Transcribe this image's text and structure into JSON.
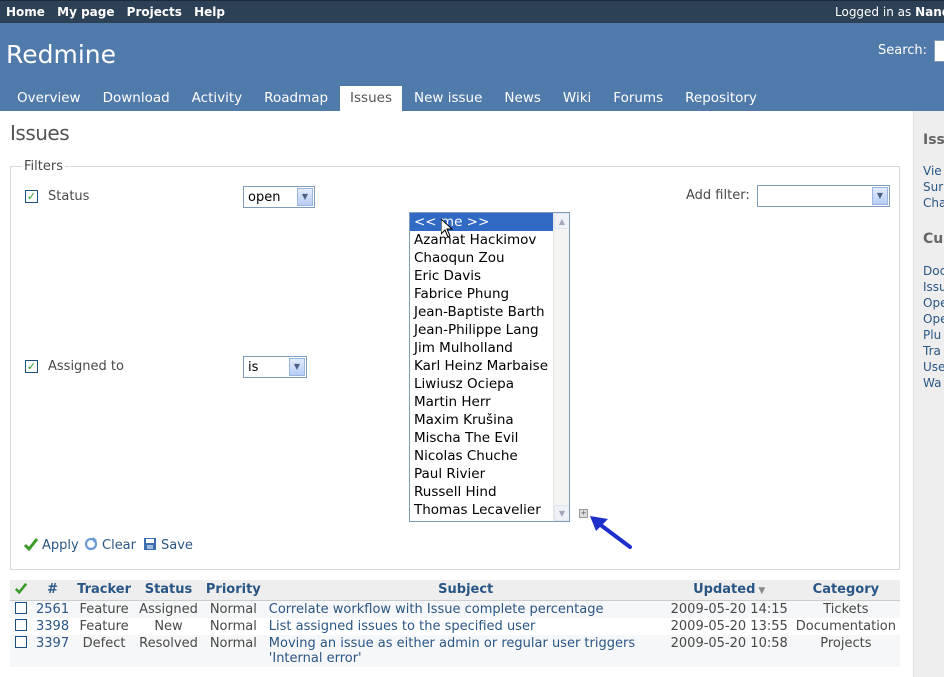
{
  "top_menu": {
    "links": [
      "Home",
      "My page",
      "Projects",
      "Help"
    ],
    "logged_as_prefix": "Logged in as",
    "logged_as_user": "Nand"
  },
  "header": {
    "title": "Redmine",
    "search_label": "Search:"
  },
  "main_menu": {
    "tabs": [
      "Overview",
      "Download",
      "Activity",
      "Roadmap",
      "Issues",
      "New issue",
      "News",
      "Wiki",
      "Forums",
      "Repository"
    ],
    "selected": "Issues"
  },
  "page": {
    "title": "Issues"
  },
  "filters": {
    "legend": "Filters",
    "status_label": "Status",
    "status_value": "open",
    "assigned_label": "Assigned to",
    "assigned_operator": "is",
    "add_filter_label": "Add filter:",
    "add_filter_value": "",
    "assignee_options": [
      "<< me >>",
      "Azamat Hackimov",
      "Chaoqun Zou",
      "Eric Davis",
      "Fabrice Phung",
      "Jean-Baptiste Barth",
      "Jean-Philippe Lang",
      "Jim Mulholland",
      "Karl Heinz Marbaise",
      "Liwiusz Ociepa",
      "Martin Herr",
      "Maxim Krušina",
      "Mischa The Evil",
      "Nicolas Chuche",
      "Paul Rivier",
      "Russell Hind",
      "Thomas Lecavelier"
    ],
    "selected_option_index": 0
  },
  "actions": {
    "apply": "Apply",
    "clear": "Clear",
    "save": "Save"
  },
  "table": {
    "headers": [
      "#",
      "Tracker",
      "Status",
      "Priority",
      "Subject",
      "Updated",
      "Category"
    ],
    "rows": [
      {
        "id": "2561",
        "tracker": "Feature",
        "status": "Assigned",
        "priority": "Normal",
        "subject": "Correlate workflow with Issue complete percentage",
        "updated": "2009-05-20 14:15",
        "category": "Tickets"
      },
      {
        "id": "3398",
        "tracker": "Feature",
        "status": "New",
        "priority": "Normal",
        "subject": "List assigned issues to the specified user",
        "updated": "2009-05-20 13:55",
        "category": "Documentation"
      },
      {
        "id": "3397",
        "tracker": "Defect",
        "status": "Resolved",
        "priority": "Normal",
        "subject": "Moving an issue as either admin or regular user triggers 'Internal error'",
        "updated": "2009-05-20 10:58",
        "category": "Projects"
      }
    ]
  },
  "sidebar": {
    "heading1": "Issu",
    "links1": [
      "Vie",
      "Sur",
      "Cha"
    ],
    "heading2": "Cus",
    "links2": [
      "Doc",
      "Issu",
      "Ope",
      "Ope",
      "Plu",
      "Tra",
      "Use",
      "Wa"
    ]
  },
  "colors": {
    "top_menu_bg": "#2C4056",
    "header_bg": "#507AAA",
    "link": "#2A5685",
    "selection": "#316AC5",
    "annotation_arrow": "#1E2FCC"
  }
}
